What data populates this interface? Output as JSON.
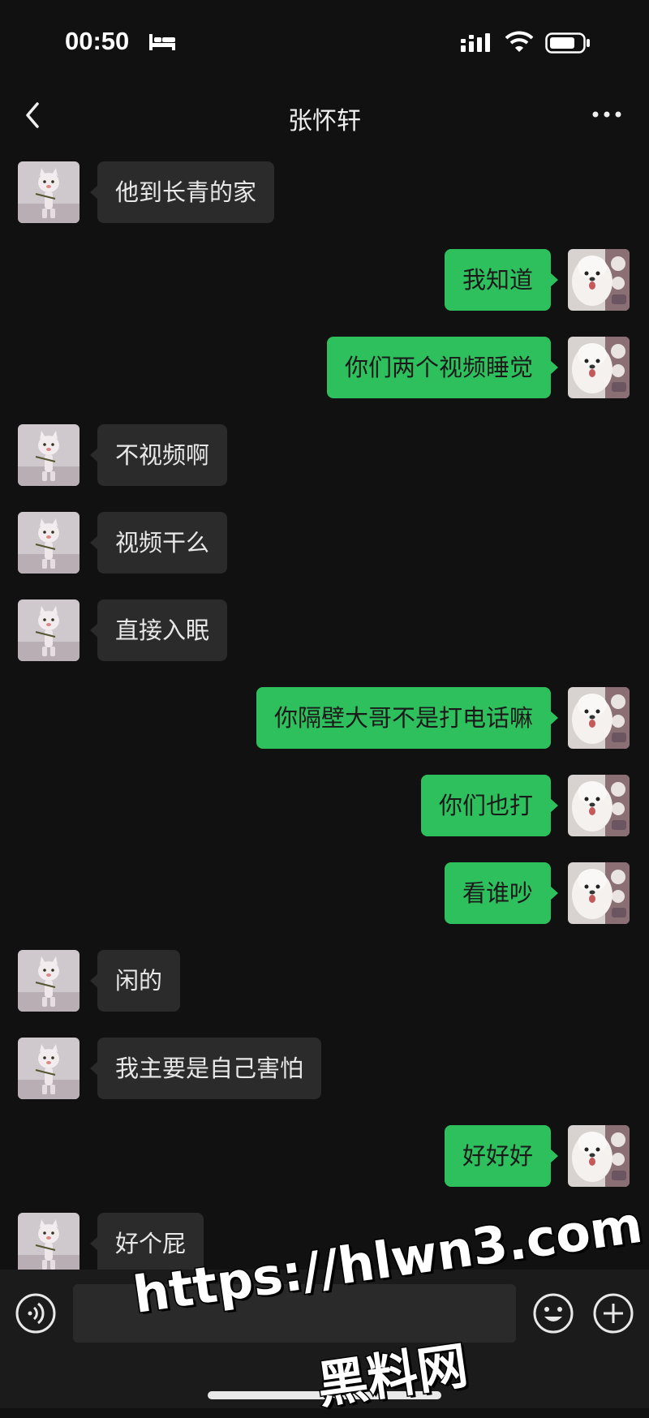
{
  "status_bar": {
    "time": "00:50",
    "icons": [
      "bed-icon",
      "signal-icon",
      "wifi-icon",
      "battery-icon"
    ]
  },
  "nav": {
    "title": "张怀轩",
    "back_icon": "chevron-left-icon",
    "more_icon": "more-icon"
  },
  "messages": [
    {
      "from": "them",
      "text": "他到长青的家"
    },
    {
      "from": "me",
      "text": "我知道"
    },
    {
      "from": "me",
      "text": "你们两个视频睡觉"
    },
    {
      "from": "them",
      "text": "不视频啊"
    },
    {
      "from": "them",
      "text": "视频干么"
    },
    {
      "from": "them",
      "text": "直接入眠"
    },
    {
      "from": "me",
      "text": "你隔壁大哥不是打电话嘛"
    },
    {
      "from": "me",
      "text": "你们也打"
    },
    {
      "from": "me",
      "text": "看谁吵"
    },
    {
      "from": "them",
      "text": "闲的"
    },
    {
      "from": "them",
      "text": "我主要是自己害怕"
    },
    {
      "from": "me",
      "text": "好好好"
    },
    {
      "from": "them",
      "text": "好个屁"
    }
  ],
  "input_bar": {
    "input_value": "",
    "icons": [
      "voice-icon",
      "emoji-icon",
      "plus-icon"
    ]
  },
  "watermark": {
    "url": "https://hlwn3.com",
    "text": "黑料网"
  },
  "colors": {
    "background": "#111111",
    "incoming_bubble": "#2b2b2b",
    "outgoing_bubble": "#2fc05e"
  }
}
